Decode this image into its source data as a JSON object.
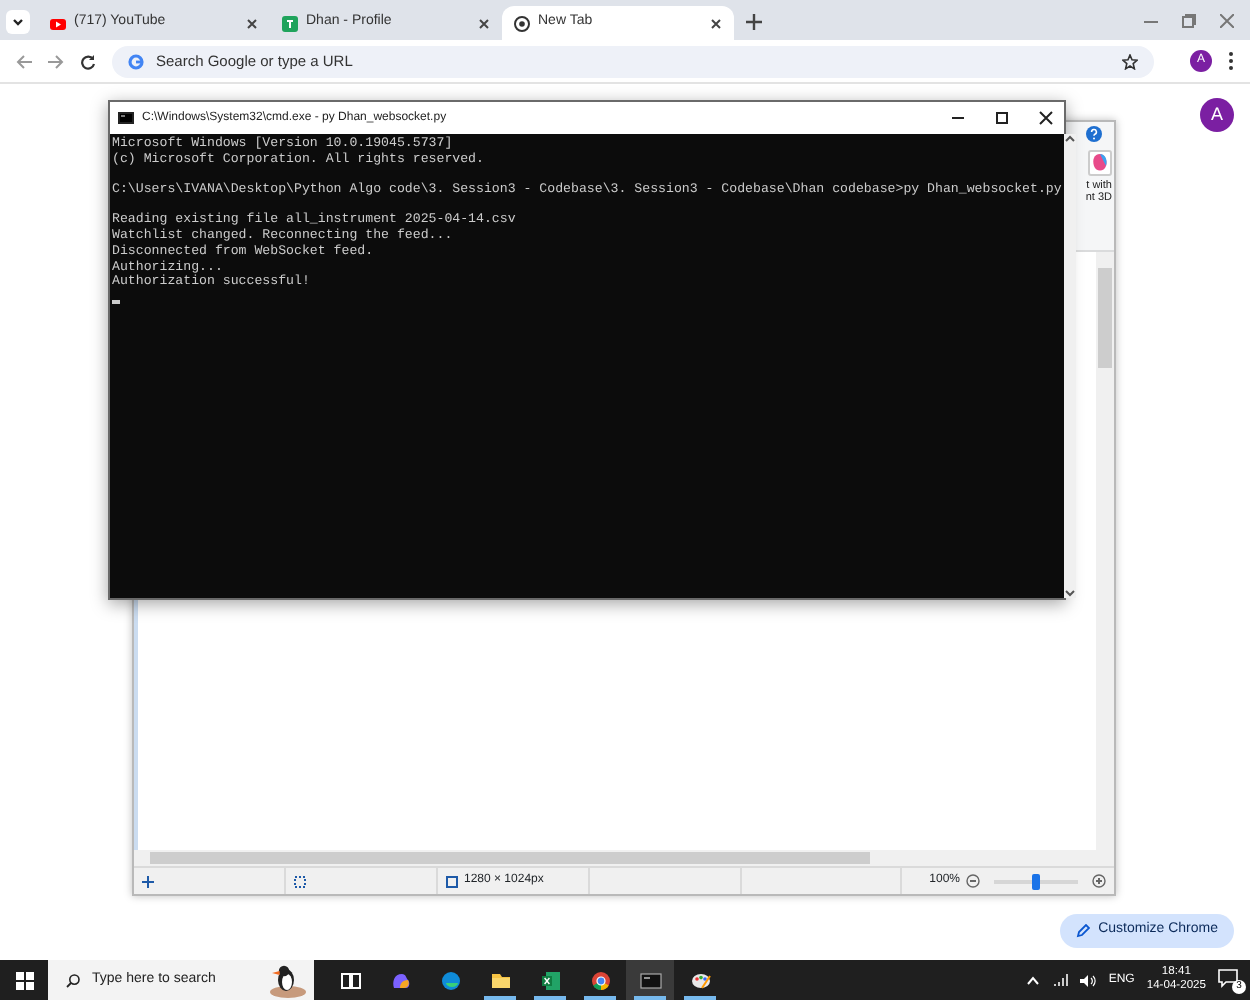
{
  "browser": {
    "tabs": [
      {
        "title": "(717) YouTube",
        "selected": false
      },
      {
        "title": "Dhan - Profile",
        "selected": false
      },
      {
        "title": "New Tab",
        "selected": true
      }
    ],
    "address_bar": {
      "placeholder": "Search Google or type a URL"
    },
    "profile_initial": "A"
  },
  "new_tab_page": {
    "profile_initial": "A",
    "customize_button": "Customize Chrome"
  },
  "paint_window": {
    "ribbon_label_lines": [
      "t with",
      "nt 3D"
    ],
    "status_bar": {
      "image_size": "1280 × 1024px",
      "zoom": "100%"
    },
    "zoom_slider": {
      "level": 0.5
    }
  },
  "console_window": {
    "title": "C:\\Windows\\System32\\cmd.exe - py  Dhan_websocket.py",
    "blocks": [
      [
        "Microsoft Windows [Version 10.0.19045.5737]",
        "(c) Microsoft Corporation. All rights reserved."
      ],
      [
        "C:\\Users\\IVANA\\Desktop\\Python Algo code\\3. Session3 - Codebase\\3. Session3 - Codebase\\Dhan codebase>py Dhan_websocket.py"
      ],
      [
        "Reading existing file all_instrument 2025-04-14.csv",
        "Watchlist changed. Reconnecting the feed...",
        "Disconnected from WebSocket feed.",
        "Authorizing...",
        "Authorization successful!"
      ]
    ],
    "cursor_visible": true
  },
  "taskbar": {
    "search_placeholder": "Type here to search",
    "apps": [
      {
        "kind": "taskview",
        "running": false,
        "selected": false
      },
      {
        "kind": "copilot",
        "running": false,
        "selected": false
      },
      {
        "kind": "edge",
        "running": false,
        "selected": false
      },
      {
        "kind": "explorer",
        "running": true,
        "selected": false
      },
      {
        "kind": "excel",
        "running": true,
        "selected": false
      },
      {
        "kind": "chrome",
        "running": true,
        "selected": false
      },
      {
        "kind": "terminal",
        "running": true,
        "selected": true
      },
      {
        "kind": "paint",
        "running": true,
        "selected": false
      }
    ],
    "language": "ENG",
    "time": "18:41",
    "date": "14-04-2025",
    "notification_count": "3"
  }
}
